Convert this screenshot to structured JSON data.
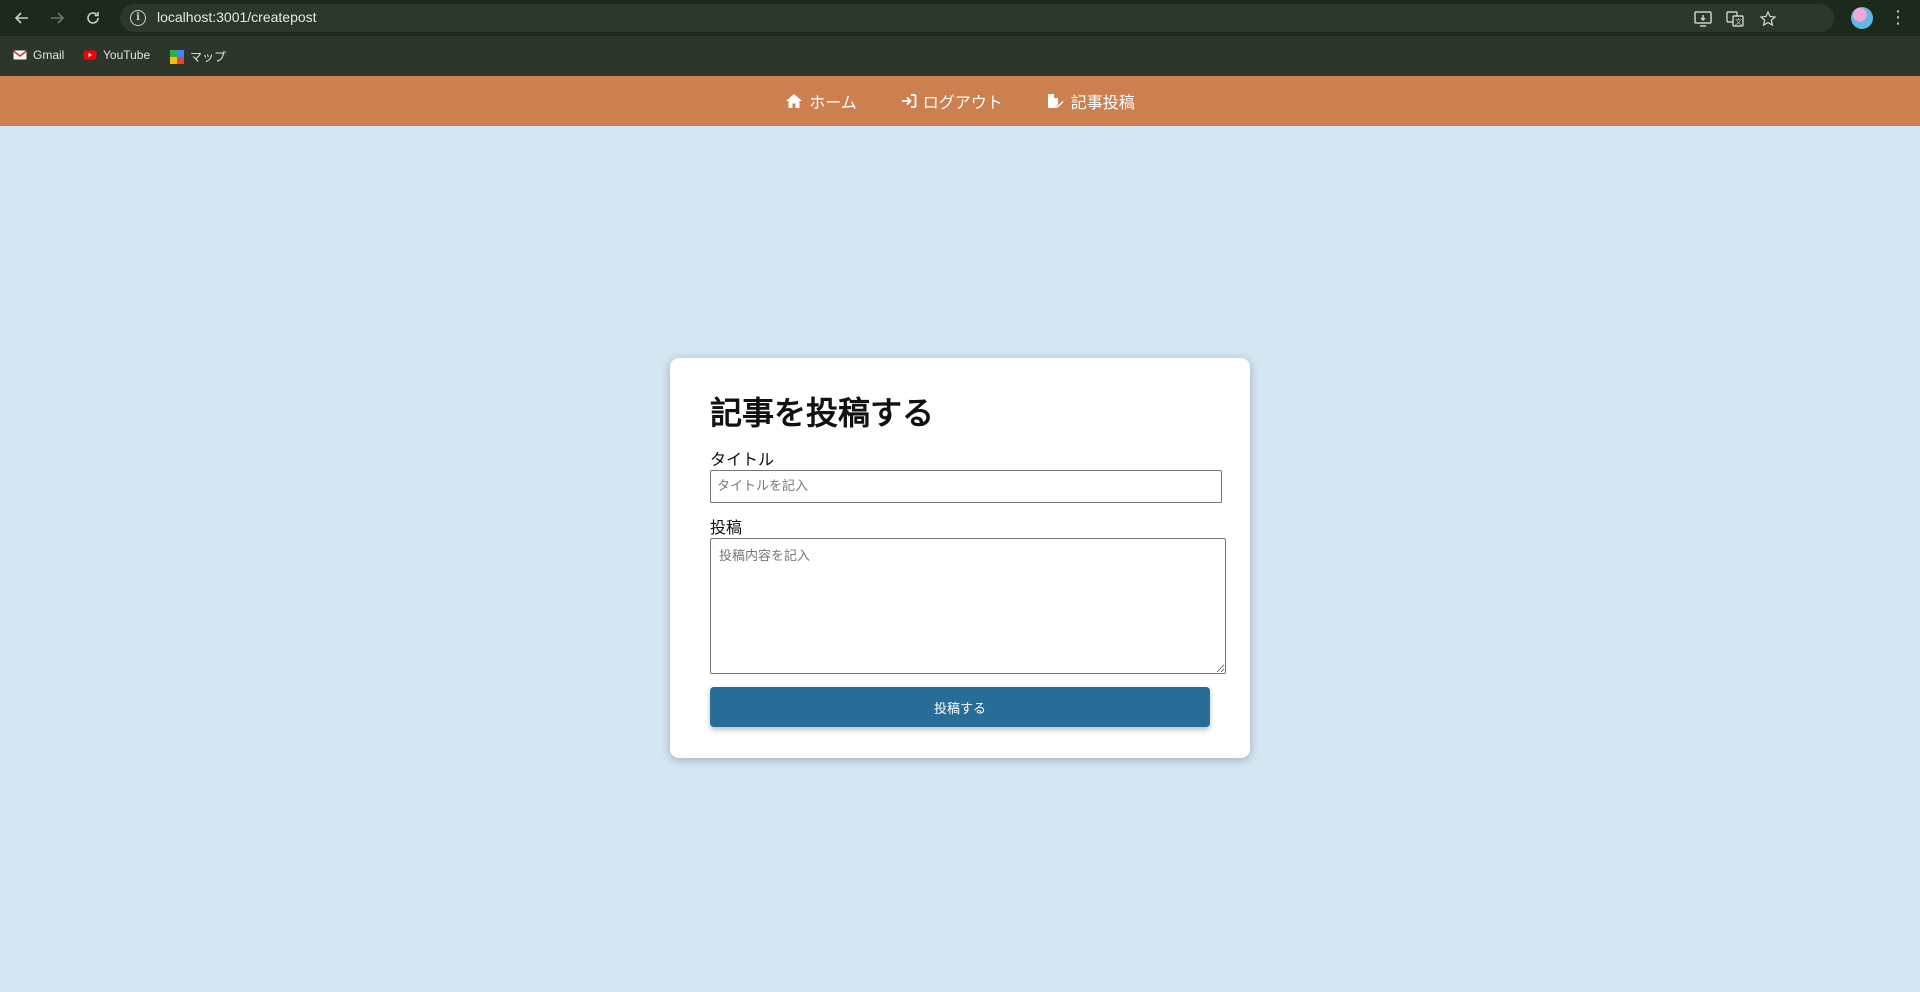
{
  "browser": {
    "url": "localhost:3001/createpost",
    "bookmarks": [
      {
        "label": "Gmail",
        "icon": "gmail-icon"
      },
      {
        "label": "YouTube",
        "icon": "youtube-icon"
      },
      {
        "label": "マップ",
        "icon": "maps-icon"
      }
    ]
  },
  "nav": {
    "home_label": "ホーム",
    "logout_label": "ログアウト",
    "createpost_label": "記事投稿",
    "color": "#cc7f4f"
  },
  "form": {
    "heading": "記事を投稿する",
    "title_label": "タイトル",
    "title_placeholder": "タイトルを記入",
    "title_value": "",
    "post_label": "投稿",
    "post_placeholder": "投稿内容を記入",
    "post_value": "",
    "submit_label": "投稿する",
    "submit_color": "#286c98"
  },
  "colors": {
    "background": "#d5e6f3",
    "browser_bar": "#1c2a1d"
  }
}
